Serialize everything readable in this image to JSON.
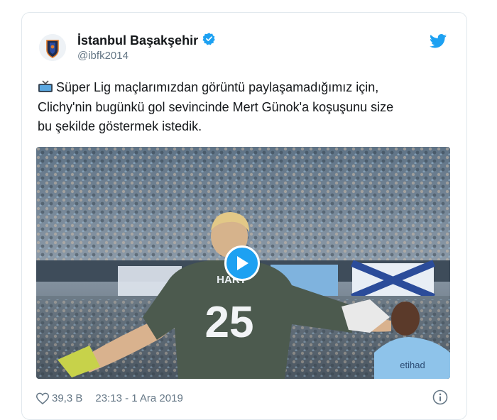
{
  "tweet": {
    "name": "İstanbul Başakşehir",
    "handle": "@ibfk2014",
    "verified": true,
    "text_lines": [
      "Süper Lig maçlarımızdan görüntü paylaşamadığımız için,",
      "Clichy'nin bugünkü gol sevincinde Mert Günok'a koşuşunu size",
      "bu şekilde göstermek istedik."
    ],
    "media": {
      "jersey_name": "HART",
      "jersey_number": "25",
      "sponsor_text": "etihad"
    },
    "likes": "39,3 B",
    "timestamp": "23:13 - 1 Ara 2019"
  },
  "icons": {
    "avatar": "club-crest-icon",
    "verified": "verified-badge-icon",
    "brand": "twitter-bird-icon",
    "emoji": "tv-icon",
    "play": "play-icon",
    "like": "heart-icon",
    "info": "info-icon"
  },
  "colors": {
    "accent": "#1da1f2",
    "text": "#14171a",
    "secondary": "#657786",
    "border": "#e1e8ed"
  }
}
